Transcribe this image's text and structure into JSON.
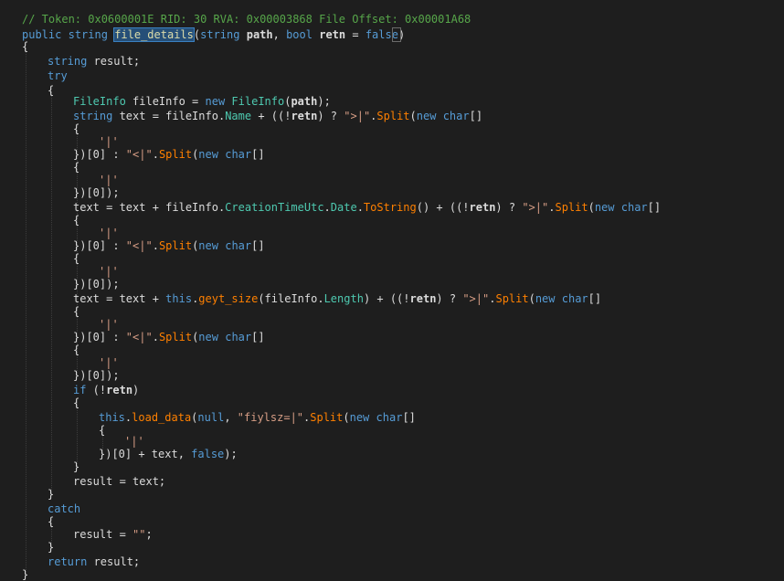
{
  "colors": {
    "background": "#1e1e1e",
    "comment": "#57a64a",
    "keyword": "#569cd6",
    "type": "#4ec9b0",
    "method": "#ff8000",
    "string": "#d69d85",
    "text": "#dcdcdc",
    "selection": "#264f78"
  },
  "lines": [
    {
      "indent": 0,
      "tokens": [
        {
          "t": "// Token: 0x0600001E RID: 30 RVA: 0x00003868 File Offset: 0x00001A68",
          "c": "comment"
        }
      ]
    },
    {
      "indent": 0,
      "tokens": [
        {
          "t": "public",
          "c": "keyword"
        },
        {
          "t": " ",
          "c": "plain"
        },
        {
          "t": "string",
          "c": "keyword"
        },
        {
          "t": " ",
          "c": "plain"
        },
        {
          "t": "file_details",
          "c": "highlight"
        },
        {
          "t": "(",
          "c": "plain"
        },
        {
          "t": "string",
          "c": "keyword"
        },
        {
          "t": " ",
          "c": "plain"
        },
        {
          "t": "path",
          "c": "bold"
        },
        {
          "t": ", ",
          "c": "plain"
        },
        {
          "t": "bool",
          "c": "keyword"
        },
        {
          "t": " ",
          "c": "plain"
        },
        {
          "t": "retn",
          "c": "bold"
        },
        {
          "t": " = ",
          "c": "plain"
        },
        {
          "t": "false",
          "c": "keyword"
        },
        {
          "t": ")",
          "c": "plain"
        }
      ]
    },
    {
      "indent": 0,
      "tokens": [
        {
          "t": "{",
          "c": "plain"
        }
      ]
    },
    {
      "indent": 1,
      "tokens": [
        {
          "t": "string",
          "c": "keyword"
        },
        {
          "t": " result;",
          "c": "plain"
        }
      ]
    },
    {
      "indent": 1,
      "tokens": [
        {
          "t": "try",
          "c": "keyword"
        }
      ]
    },
    {
      "indent": 1,
      "tokens": [
        {
          "t": "{",
          "c": "plain"
        }
      ]
    },
    {
      "indent": 2,
      "tokens": [
        {
          "t": "FileInfo",
          "c": "type"
        },
        {
          "t": " fileInfo = ",
          "c": "plain"
        },
        {
          "t": "new",
          "c": "keyword"
        },
        {
          "t": " ",
          "c": "plain"
        },
        {
          "t": "FileInfo",
          "c": "type"
        },
        {
          "t": "(",
          "c": "plain"
        },
        {
          "t": "path",
          "c": "bold"
        },
        {
          "t": ");",
          "c": "plain"
        }
      ]
    },
    {
      "indent": 2,
      "tokens": [
        {
          "t": "string",
          "c": "keyword"
        },
        {
          "t": " text = fileInfo.",
          "c": "plain"
        },
        {
          "t": "Name",
          "c": "prop"
        },
        {
          "t": " + ((!",
          "c": "plain"
        },
        {
          "t": "retn",
          "c": "bold"
        },
        {
          "t": ") ? ",
          "c": "plain"
        },
        {
          "t": "\">|\"",
          "c": "string"
        },
        {
          "t": ".",
          "c": "plain"
        },
        {
          "t": "Split",
          "c": "method"
        },
        {
          "t": "(",
          "c": "plain"
        },
        {
          "t": "new",
          "c": "keyword"
        },
        {
          "t": " ",
          "c": "plain"
        },
        {
          "t": "char",
          "c": "keyword"
        },
        {
          "t": "[]",
          "c": "plain"
        }
      ]
    },
    {
      "indent": 2,
      "tokens": [
        {
          "t": "{",
          "c": "plain"
        }
      ]
    },
    {
      "indent": 3,
      "tokens": [
        {
          "t": "'|'",
          "c": "string"
        }
      ]
    },
    {
      "indent": 2,
      "tokens": [
        {
          "t": "})[0] : ",
          "c": "plain"
        },
        {
          "t": "\"<|\"",
          "c": "string"
        },
        {
          "t": ".",
          "c": "plain"
        },
        {
          "t": "Split",
          "c": "method"
        },
        {
          "t": "(",
          "c": "plain"
        },
        {
          "t": "new",
          "c": "keyword"
        },
        {
          "t": " ",
          "c": "plain"
        },
        {
          "t": "char",
          "c": "keyword"
        },
        {
          "t": "[]",
          "c": "plain"
        }
      ]
    },
    {
      "indent": 2,
      "tokens": [
        {
          "t": "{",
          "c": "plain"
        }
      ]
    },
    {
      "indent": 3,
      "tokens": [
        {
          "t": "'|'",
          "c": "string"
        }
      ]
    },
    {
      "indent": 2,
      "tokens": [
        {
          "t": "})[0]);",
          "c": "plain"
        }
      ]
    },
    {
      "indent": 2,
      "tokens": [
        {
          "t": "text = text + fileInfo.",
          "c": "plain"
        },
        {
          "t": "CreationTimeUtc",
          "c": "prop"
        },
        {
          "t": ".",
          "c": "plain"
        },
        {
          "t": "Date",
          "c": "prop"
        },
        {
          "t": ".",
          "c": "plain"
        },
        {
          "t": "ToString",
          "c": "method"
        },
        {
          "t": "() + ((!",
          "c": "plain"
        },
        {
          "t": "retn",
          "c": "bold"
        },
        {
          "t": ") ? ",
          "c": "plain"
        },
        {
          "t": "\">|\"",
          "c": "string"
        },
        {
          "t": ".",
          "c": "plain"
        },
        {
          "t": "Split",
          "c": "method"
        },
        {
          "t": "(",
          "c": "plain"
        },
        {
          "t": "new",
          "c": "keyword"
        },
        {
          "t": " ",
          "c": "plain"
        },
        {
          "t": "char",
          "c": "keyword"
        },
        {
          "t": "[]",
          "c": "plain"
        }
      ]
    },
    {
      "indent": 2,
      "tokens": [
        {
          "t": "{",
          "c": "plain"
        }
      ]
    },
    {
      "indent": 3,
      "tokens": [
        {
          "t": "'|'",
          "c": "string"
        }
      ]
    },
    {
      "indent": 2,
      "tokens": [
        {
          "t": "})[0] : ",
          "c": "plain"
        },
        {
          "t": "\"<|\"",
          "c": "string"
        },
        {
          "t": ".",
          "c": "plain"
        },
        {
          "t": "Split",
          "c": "method"
        },
        {
          "t": "(",
          "c": "plain"
        },
        {
          "t": "new",
          "c": "keyword"
        },
        {
          "t": " ",
          "c": "plain"
        },
        {
          "t": "char",
          "c": "keyword"
        },
        {
          "t": "[]",
          "c": "plain"
        }
      ]
    },
    {
      "indent": 2,
      "tokens": [
        {
          "t": "{",
          "c": "plain"
        }
      ]
    },
    {
      "indent": 3,
      "tokens": [
        {
          "t": "'|'",
          "c": "string"
        }
      ]
    },
    {
      "indent": 2,
      "tokens": [
        {
          "t": "})[0]);",
          "c": "plain"
        }
      ]
    },
    {
      "indent": 2,
      "tokens": [
        {
          "t": "text = text + ",
          "c": "plain"
        },
        {
          "t": "this",
          "c": "keyword"
        },
        {
          "t": ".",
          "c": "plain"
        },
        {
          "t": "geyt_size",
          "c": "method"
        },
        {
          "t": "(fileInfo.",
          "c": "plain"
        },
        {
          "t": "Length",
          "c": "prop"
        },
        {
          "t": ") + ((!",
          "c": "plain"
        },
        {
          "t": "retn",
          "c": "bold"
        },
        {
          "t": ") ? ",
          "c": "plain"
        },
        {
          "t": "\">|\"",
          "c": "string"
        },
        {
          "t": ".",
          "c": "plain"
        },
        {
          "t": "Split",
          "c": "method"
        },
        {
          "t": "(",
          "c": "plain"
        },
        {
          "t": "new",
          "c": "keyword"
        },
        {
          "t": " ",
          "c": "plain"
        },
        {
          "t": "char",
          "c": "keyword"
        },
        {
          "t": "[]",
          "c": "plain"
        }
      ]
    },
    {
      "indent": 2,
      "tokens": [
        {
          "t": "{",
          "c": "plain"
        }
      ]
    },
    {
      "indent": 3,
      "tokens": [
        {
          "t": "'|'",
          "c": "string"
        }
      ]
    },
    {
      "indent": 2,
      "tokens": [
        {
          "t": "})[0] : ",
          "c": "plain"
        },
        {
          "t": "\"<|\"",
          "c": "string"
        },
        {
          "t": ".",
          "c": "plain"
        },
        {
          "t": "Split",
          "c": "method"
        },
        {
          "t": "(",
          "c": "plain"
        },
        {
          "t": "new",
          "c": "keyword"
        },
        {
          "t": " ",
          "c": "plain"
        },
        {
          "t": "char",
          "c": "keyword"
        },
        {
          "t": "[]",
          "c": "plain"
        }
      ]
    },
    {
      "indent": 2,
      "tokens": [
        {
          "t": "{",
          "c": "plain"
        }
      ]
    },
    {
      "indent": 3,
      "tokens": [
        {
          "t": "'|'",
          "c": "string"
        }
      ]
    },
    {
      "indent": 2,
      "tokens": [
        {
          "t": "})[0]);",
          "c": "plain"
        }
      ]
    },
    {
      "indent": 2,
      "tokens": [
        {
          "t": "if",
          "c": "keyword"
        },
        {
          "t": " (!",
          "c": "plain"
        },
        {
          "t": "retn",
          "c": "bold"
        },
        {
          "t": ")",
          "c": "plain"
        }
      ]
    },
    {
      "indent": 2,
      "tokens": [
        {
          "t": "{",
          "c": "plain"
        }
      ]
    },
    {
      "indent": 3,
      "tokens": [
        {
          "t": "this",
          "c": "keyword"
        },
        {
          "t": ".",
          "c": "plain"
        },
        {
          "t": "load_data",
          "c": "method"
        },
        {
          "t": "(",
          "c": "plain"
        },
        {
          "t": "null",
          "c": "keyword"
        },
        {
          "t": ", ",
          "c": "plain"
        },
        {
          "t": "\"fiylsz=|\"",
          "c": "string"
        },
        {
          "t": ".",
          "c": "plain"
        },
        {
          "t": "Split",
          "c": "method"
        },
        {
          "t": "(",
          "c": "plain"
        },
        {
          "t": "new",
          "c": "keyword"
        },
        {
          "t": " ",
          "c": "plain"
        },
        {
          "t": "char",
          "c": "keyword"
        },
        {
          "t": "[]",
          "c": "plain"
        }
      ]
    },
    {
      "indent": 3,
      "tokens": [
        {
          "t": "{",
          "c": "plain"
        }
      ]
    },
    {
      "indent": 4,
      "tokens": [
        {
          "t": "'|'",
          "c": "string"
        }
      ]
    },
    {
      "indent": 3,
      "tokens": [
        {
          "t": "})[0] + text, ",
          "c": "plain"
        },
        {
          "t": "false",
          "c": "keyword"
        },
        {
          "t": ");",
          "c": "plain"
        }
      ]
    },
    {
      "indent": 2,
      "tokens": [
        {
          "t": "}",
          "c": "plain"
        }
      ]
    },
    {
      "indent": 2,
      "tokens": [
        {
          "t": "result = text;",
          "c": "plain"
        }
      ]
    },
    {
      "indent": 1,
      "tokens": [
        {
          "t": "}",
          "c": "plain"
        }
      ]
    },
    {
      "indent": 1,
      "tokens": [
        {
          "t": "catch",
          "c": "keyword"
        }
      ]
    },
    {
      "indent": 1,
      "tokens": [
        {
          "t": "{",
          "c": "plain"
        }
      ]
    },
    {
      "indent": 2,
      "tokens": [
        {
          "t": "result = ",
          "c": "plain"
        },
        {
          "t": "\"\"",
          "c": "string"
        },
        {
          "t": ";",
          "c": "plain"
        }
      ]
    },
    {
      "indent": 1,
      "tokens": [
        {
          "t": "}",
          "c": "plain"
        }
      ]
    },
    {
      "indent": 1,
      "tokens": [
        {
          "t": "return",
          "c": "keyword"
        },
        {
          "t": " result;",
          "c": "plain"
        }
      ]
    },
    {
      "indent": 0,
      "tokens": [
        {
          "t": "}",
          "c": "plain"
        }
      ]
    }
  ]
}
